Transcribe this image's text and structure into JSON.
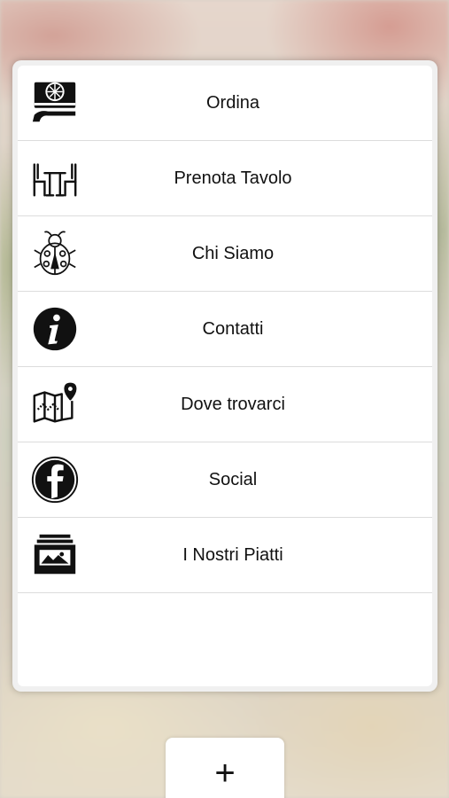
{
  "menu": {
    "items": [
      {
        "label": "Ordina",
        "icon": "pizza-delivery-icon"
      },
      {
        "label": "Prenota Tavolo",
        "icon": "table-chairs-icon"
      },
      {
        "label": "Chi Siamo",
        "icon": "ladybug-icon"
      },
      {
        "label": "Contatti",
        "icon": "info-icon"
      },
      {
        "label": "Dove trovarci",
        "icon": "map-pin-icon"
      },
      {
        "label": "Social",
        "icon": "facebook-icon"
      },
      {
        "label": "I Nostri Piatti",
        "icon": "photo-gallery-icon"
      }
    ]
  },
  "fab": {
    "label": "+"
  },
  "colors": {
    "panel_bg": "#ffffff",
    "panel_border": "#f0f0f0",
    "divider": "#dcdcdc",
    "text": "#111111"
  }
}
